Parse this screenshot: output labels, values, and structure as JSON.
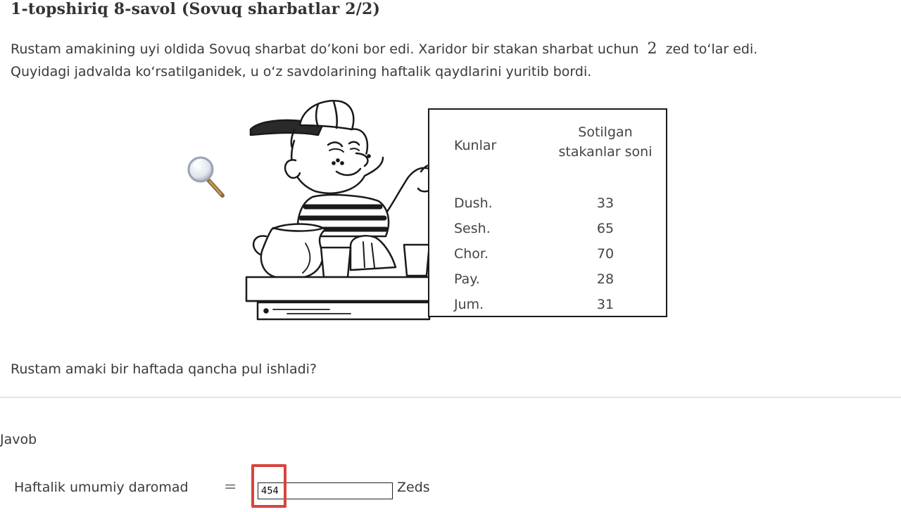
{
  "title": "1-topshiriq 8-savol (Sovuq sharbatlar 2/2)",
  "intro": {
    "line1_before": "Rustam amakining uyi oldida Sovuq sharbat do’koni bor edi. Xaridor bir stakan sharbat uchun",
    "price": "2",
    "line1_after": "zed to‘lar edi.",
    "line2": "Quyidagi jadvalda ko‘rsatilganidek, u o‘z savdolarining haftalik qaydlarini yuritib bordi."
  },
  "table": {
    "col_days": "Kunlar",
    "col_sold_line1": "Sotilgan",
    "col_sold_line2": "stakanlar soni",
    "rows": [
      {
        "day": "Dush.",
        "value": "33"
      },
      {
        "day": "Sesh.",
        "value": "65"
      },
      {
        "day": "Chor.",
        "value": "70"
      },
      {
        "day": "Pay.",
        "value": "28"
      },
      {
        "day": "Jum.",
        "value": "31"
      }
    ]
  },
  "question": "Rustam amaki bir haftada qancha pul ishladi?",
  "answer": {
    "section_label": "Javob",
    "label": "Haftalik umumiy daromad",
    "equals": "=",
    "value": "454",
    "unit": "Zeds"
  },
  "icons": {
    "magnifier": "magnifier-icon"
  },
  "colors": {
    "highlight": "#d6453d",
    "text": "#3a3a3a"
  }
}
